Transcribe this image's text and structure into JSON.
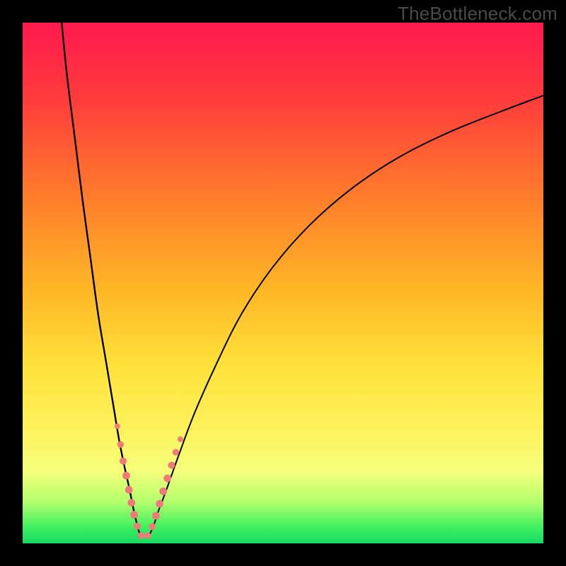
{
  "watermark": "TheBottleneck.com",
  "colors": {
    "frame": "#000000",
    "gradient_top": "#ff1a4d",
    "gradient_mid": "#ffe23a",
    "gradient_bottom": "#17d964",
    "curve": "#000000",
    "dots": "#f07a7a"
  },
  "chart_data": {
    "type": "line",
    "title": "",
    "xlabel": "",
    "ylabel": "",
    "xlim": [
      0,
      100
    ],
    "ylim": [
      0,
      100
    ],
    "grid": false,
    "legend": false,
    "series": [
      {
        "name": "left-curve",
        "x": [
          7.5,
          8.5,
          10,
          11.5,
          13,
          14.5,
          16,
          17.5,
          18.5,
          19.5,
          20.5,
          21.3,
          22,
          22.7
        ],
        "y": [
          100,
          90,
          78,
          66,
          55,
          44,
          35,
          26,
          20,
          15,
          10.5,
          6.5,
          3.5,
          1
        ]
      },
      {
        "name": "right-curve",
        "x": [
          24,
          25,
          26,
          27.5,
          30,
          33,
          37,
          42,
          48,
          55,
          63,
          72,
          82,
          92,
          100
        ],
        "y": [
          1,
          3,
          6,
          10,
          17,
          25,
          34,
          44,
          53,
          61,
          68,
          74,
          79,
          83,
          86
        ]
      }
    ],
    "annotations": {
      "dots_left": [
        {
          "x": 18.2,
          "y": 22.5,
          "r": 1.1
        },
        {
          "x": 18.8,
          "y": 19.0,
          "r": 1.3
        },
        {
          "x": 19.3,
          "y": 15.8,
          "r": 1.4
        },
        {
          "x": 19.9,
          "y": 13.0,
          "r": 1.5
        },
        {
          "x": 20.4,
          "y": 10.3,
          "r": 1.5
        },
        {
          "x": 20.9,
          "y": 7.8,
          "r": 1.5
        },
        {
          "x": 21.4,
          "y": 5.5,
          "r": 1.5
        },
        {
          "x": 22.0,
          "y": 3.3,
          "r": 1.4
        },
        {
          "x": 22.7,
          "y": 1.5,
          "r": 1.3
        }
      ],
      "dots_right": [
        {
          "x": 24.0,
          "y": 1.5,
          "r": 1.3
        },
        {
          "x": 24.9,
          "y": 3.2,
          "r": 1.4
        },
        {
          "x": 25.6,
          "y": 5.3,
          "r": 1.5
        },
        {
          "x": 26.3,
          "y": 7.6,
          "r": 1.5
        },
        {
          "x": 27.0,
          "y": 10.0,
          "r": 1.5
        },
        {
          "x": 27.8,
          "y": 12.5,
          "r": 1.5
        },
        {
          "x": 28.6,
          "y": 15.0,
          "r": 1.4
        },
        {
          "x": 29.4,
          "y": 17.5,
          "r": 1.3
        },
        {
          "x": 30.3,
          "y": 20.0,
          "r": 1.1
        }
      ]
    }
  }
}
